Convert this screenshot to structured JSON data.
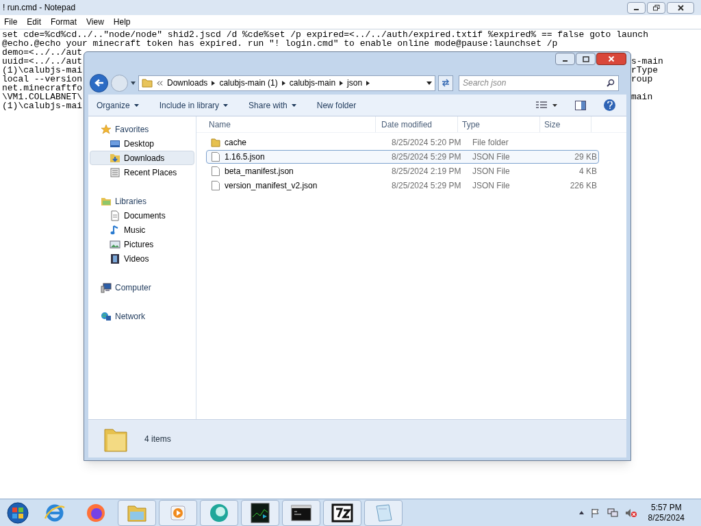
{
  "notepad": {
    "title": "! run.cmd - Notepad",
    "menu": [
      "File",
      "Edit",
      "Format",
      "View",
      "Help"
    ],
    "lines": [
      {
        "left": "set cde=%cd%cd../..\"node/node\" shid2.jscd /d %cde%set /p expired=<../../auth/expired.txtif %expired% == false goto launch"
      },
      {
        "left": "@echo.@echo your minecraft token has expired. run \"! login.cmd\" to enable online mode@pause:launchset /p"
      },
      {
        "left": "demo=<../../aut"
      },
      {
        "left": "uuid=<../../aut",
        "right": "s-main"
      },
      {
        "left": "(1)\\calubjs-mai",
        "right": "rType"
      },
      {
        "left": "local --version",
        "right": "roup"
      },
      {
        "left": "net.minecraftfo"
      },
      {
        "left": "\\VM1.COLLABNET\\",
        "right": "main"
      },
      {
        "left": "(1)\\calubjs-mai"
      }
    ]
  },
  "explorer": {
    "breadcrumb": [
      "Downloads",
      "calubjs-main (1)",
      "calubjs-main",
      "json"
    ],
    "search": {
      "placeholder": "Search json"
    },
    "toolbar": [
      {
        "label": "Organize",
        "dropdown": true
      },
      {
        "label": "Include in library",
        "dropdown": true
      },
      {
        "label": "Share with",
        "dropdown": true
      },
      {
        "label": "New folder",
        "dropdown": false
      }
    ],
    "columns": [
      "Name",
      "Date modified",
      "Type",
      "Size"
    ],
    "nav": [
      {
        "label": "Favorites",
        "kind": "star",
        "children": [
          {
            "label": "Desktop",
            "kind": "desktop",
            "selected": false
          },
          {
            "label": "Downloads",
            "kind": "downloads",
            "selected": true
          },
          {
            "label": "Recent Places",
            "kind": "recent",
            "selected": false
          }
        ]
      },
      {
        "label": "Libraries",
        "kind": "libraries",
        "children": [
          {
            "label": "Documents",
            "kind": "document",
            "selected": false
          },
          {
            "label": "Music",
            "kind": "music",
            "selected": false
          },
          {
            "label": "Pictures",
            "kind": "pictures",
            "selected": false
          },
          {
            "label": "Videos",
            "kind": "videos",
            "selected": false
          }
        ]
      },
      {
        "label": "Computer",
        "kind": "computer"
      },
      {
        "label": "Network",
        "kind": "network"
      }
    ],
    "files": [
      {
        "name": "cache",
        "date": "8/25/2024 5:20 PM",
        "type": "File folder",
        "kind": "folder",
        "selected": false
      },
      {
        "name": "1.16.5.json",
        "date": "8/25/2024 5:29 PM",
        "type": "JSON File",
        "size": "29 KB",
        "kind": "file",
        "selected": true
      },
      {
        "name": "beta_manifest.json",
        "date": "8/25/2024 2:19 PM",
        "type": "JSON File",
        "size": "4 KB",
        "kind": "file",
        "selected": false
      },
      {
        "name": "version_manifest_v2.json",
        "date": "8/25/2024 5:29 PM",
        "type": "JSON File",
        "size": "226 KB",
        "kind": "file",
        "selected": false
      }
    ],
    "status": "4 items"
  },
  "taskbar": {
    "apps": [
      {
        "kind": "start"
      },
      {
        "kind": "ie"
      },
      {
        "kind": "firefox"
      },
      {
        "kind": "explorer"
      },
      {
        "kind": "media"
      },
      {
        "kind": "orb"
      },
      {
        "kind": "monitor"
      },
      {
        "kind": "cmd"
      },
      {
        "kind": "archiver"
      },
      {
        "kind": "notepad"
      }
    ],
    "time": "5:57 PM",
    "date": "8/25/2024"
  }
}
